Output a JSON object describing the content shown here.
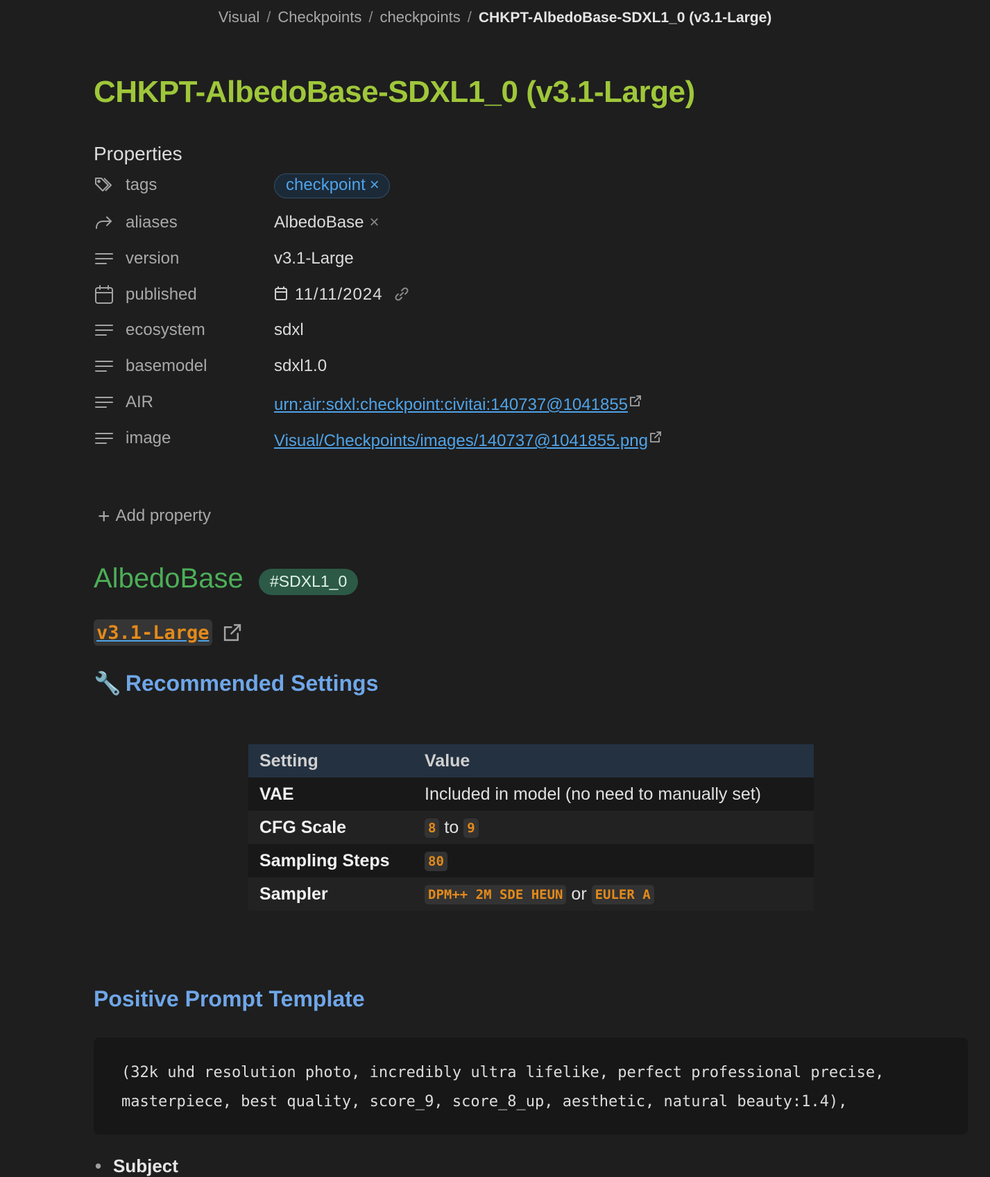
{
  "breadcrumb": {
    "items": [
      "Visual",
      "Checkpoints",
      "checkpoints"
    ],
    "current": "CHKPT-AlbedoBase-SDXL1_0 (v3.1-Large)"
  },
  "page_title": "CHKPT-AlbedoBase-SDXL1_0 (v3.1-Large)",
  "properties": {
    "heading": "Properties",
    "tags": {
      "key": "tags",
      "value": "checkpoint",
      "remove": "×",
      "icon": "tags-icon"
    },
    "aliases": {
      "key": "aliases",
      "value": "AlbedoBase",
      "remove": "×",
      "icon": "alias-arrow-icon"
    },
    "version": {
      "key": "version",
      "value": "v3.1-Large",
      "icon": "text-lines-icon"
    },
    "published": {
      "key": "published",
      "value": "11/11/2024",
      "icon": "calendar-icon"
    },
    "ecosystem": {
      "key": "ecosystem",
      "value": "sdxl",
      "icon": "text-lines-icon"
    },
    "basemodel": {
      "key": "basemodel",
      "value": "sdxl1.0",
      "icon": "text-lines-icon"
    },
    "air": {
      "key": "AIR",
      "value": "urn:air:sdxl:checkpoint:civitai:140737@1041855",
      "icon": "text-lines-icon"
    },
    "image": {
      "key": "image",
      "value": "Visual/Checkpoints/images/140737@1041855.png",
      "icon": "text-lines-icon"
    },
    "add_label": "Add property"
  },
  "section": {
    "title": "AlbedoBase",
    "hashtag": "#SDXL1_0",
    "version_code": "v3.1-Large"
  },
  "settings": {
    "heading_emoji": "🔧",
    "heading": "Recommended Settings",
    "columns": [
      "Setting",
      "Value"
    ],
    "rows": {
      "vae": {
        "key": "VAE",
        "value": "Included in model (no need to manually set)"
      },
      "cfg": {
        "key": "CFG Scale",
        "low": "8",
        "joiner": "to",
        "high": "9"
      },
      "steps": {
        "key": "Sampling Steps",
        "value": "80"
      },
      "sampler": {
        "key": "Sampler",
        "a": "DPM++ 2M SDE HEUN",
        "joiner": "or",
        "b": "EULER A"
      }
    }
  },
  "prompt": {
    "heading": "Positive Prompt Template",
    "text": "(32k uhd resolution photo, incredibly ultra lifelike, perfect professional precise,\nmasterpiece, best quality, score_9, score_8_up, aesthetic, natural beauty:1.4),"
  },
  "list": {
    "first_item": "Subject"
  },
  "colors": {
    "background": "#1e1e1e",
    "title_green": "#9fc73a",
    "heading_green": "#4cae58",
    "heading_blue": "#6fa6e8",
    "link_blue": "#4fa3e8",
    "code_orange": "#e48a1a"
  }
}
